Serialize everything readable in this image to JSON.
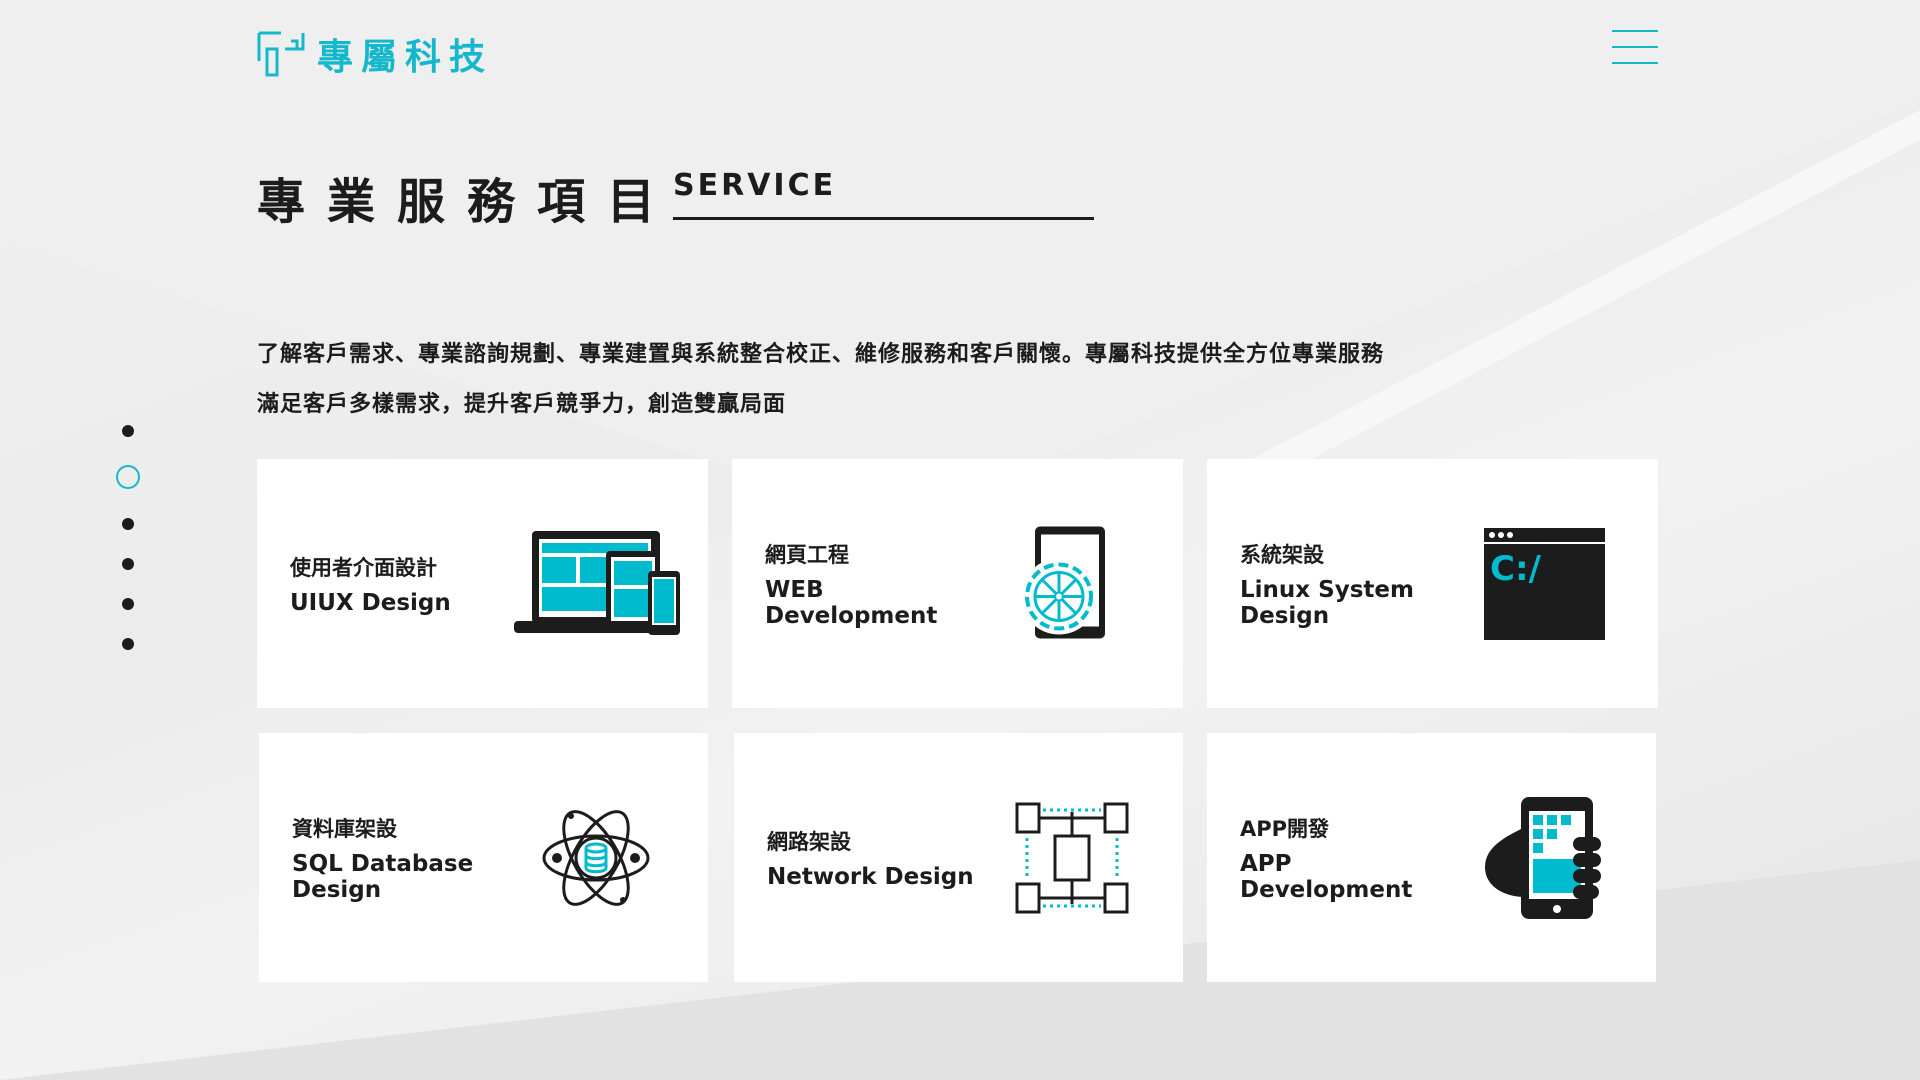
{
  "header": {
    "logo_text": "專屬科技",
    "menu_icon": "hamburger-icon"
  },
  "section": {
    "title": "專業服務項目",
    "subtitle": "SERVICE",
    "description": [
      "了解客戶需求、專業諮詢規劃、專業建置與系統整合校正、維修服務和客戶關懷。專屬科技提供全方位專業服務",
      "滿足客戶多樣需求，提升客戶競爭力，創造雙贏局面"
    ]
  },
  "pager": {
    "count": 6,
    "active": 2
  },
  "colors": {
    "accent": "#14b8cc",
    "dark": "#1c1c1c"
  },
  "services": [
    {
      "zh": "使用者介面設計",
      "en": "UIUX Design",
      "icon": "responsive-devices-icon"
    },
    {
      "zh": "網頁工程",
      "en": "WEB\nDevelopment",
      "icon": "tablet-gear-icon"
    },
    {
      "zh": "系統架設",
      "en": "Linux System\nDesign",
      "icon": "terminal-icon"
    },
    {
      "zh": "資料庫架設",
      "en": "SQL Database\nDesign",
      "icon": "database-atom-icon"
    },
    {
      "zh": "網路架設",
      "en": "Network Design",
      "icon": "network-servers-icon"
    },
    {
      "zh": "APP開發",
      "en": "APP\nDevelopment",
      "icon": "hand-phone-icon"
    }
  ]
}
